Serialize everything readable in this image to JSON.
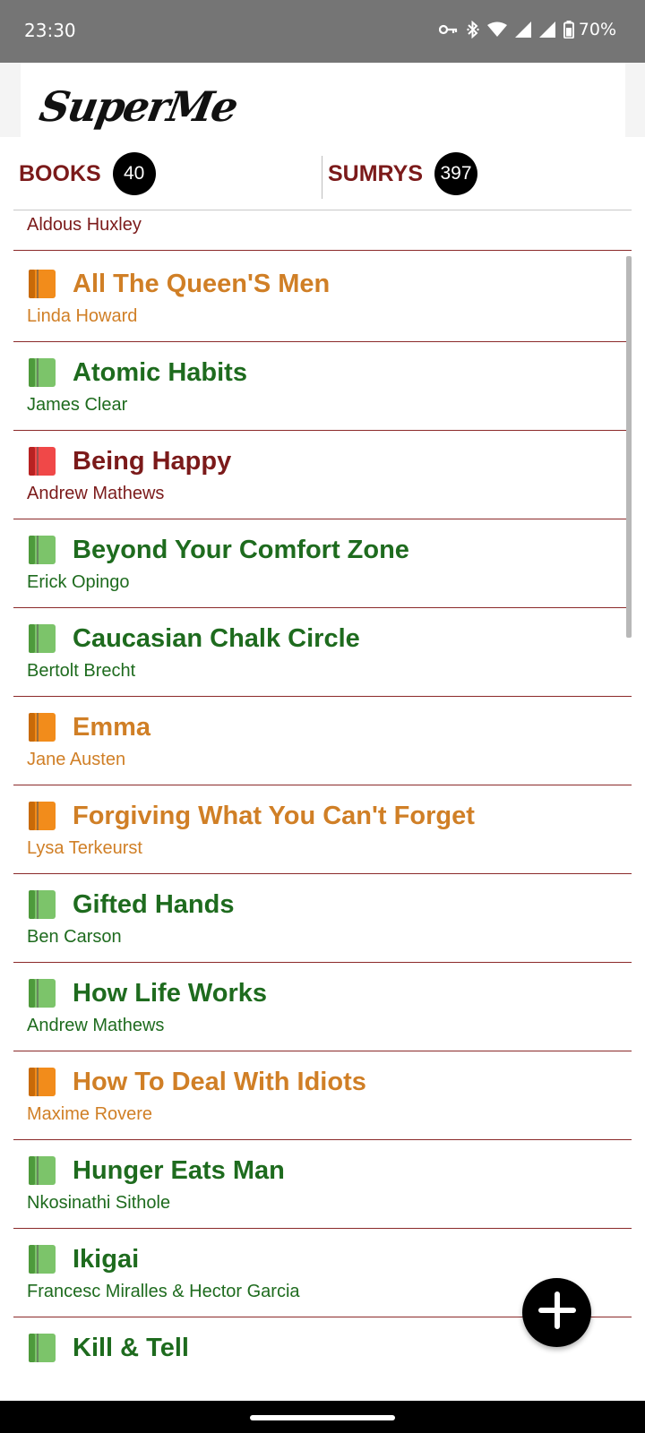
{
  "status_bar": {
    "time": "23:30",
    "icons": [
      "vpn-key-icon",
      "bluetooth-icon",
      "wifi-icon",
      "signal-icon",
      "signal-icon",
      "battery-icon"
    ],
    "battery": "70%"
  },
  "header": {
    "logo_text": "SuperMe"
  },
  "tabs": {
    "books": {
      "label": "BOOKS",
      "count": "40"
    },
    "sumrys": {
      "label": "SUMRYS",
      "count": "397"
    }
  },
  "list": {
    "partial_author": "Aldous Huxley",
    "items": [
      {
        "title": "All The Queen'S Men",
        "author": "Linda Howard",
        "icon": "orange-book-icon",
        "color": "#d07f26"
      },
      {
        "title": "Atomic Habits",
        "author": "James Clear",
        "icon": "green-book-icon",
        "color": "#1e6b1e"
      },
      {
        "title": "Being Happy",
        "author": "Andrew Mathews",
        "icon": "red-book-icon",
        "color": "#7b1a1a"
      },
      {
        "title": "Beyond Your Comfort Zone",
        "author": "Erick Opingo",
        "icon": "green-book-icon",
        "color": "#1e6b1e"
      },
      {
        "title": "Caucasian Chalk Circle",
        "author": "Bertolt Brecht",
        "icon": "green-book-icon",
        "color": "#1e6b1e"
      },
      {
        "title": "Emma",
        "author": "Jane Austen",
        "icon": "orange-book-icon",
        "color": "#d07f26"
      },
      {
        "title": "Forgiving What You Can't Forget",
        "author": "Lysa Terkeurst",
        "icon": "orange-book-icon",
        "color": "#d07f26"
      },
      {
        "title": "Gifted Hands",
        "author": "Ben Carson",
        "icon": "green-book-icon",
        "color": "#1e6b1e"
      },
      {
        "title": "How Life Works",
        "author": "Andrew Mathews",
        "icon": "green-book-icon",
        "color": "#1e6b1e"
      },
      {
        "title": "How To Deal With Idiots",
        "author": "Maxime Rovere",
        "icon": "orange-book-icon",
        "color": "#d07f26"
      },
      {
        "title": "Hunger Eats Man",
        "author": "Nkosinathi Sithole",
        "icon": "green-book-icon",
        "color": "#1e6b1e"
      },
      {
        "title": "Ikigai",
        "author": "Francesc Miralles & Hector Garcia",
        "icon": "green-book-icon",
        "color": "#1e6b1e"
      },
      {
        "title": "Kill & Tell",
        "author": "",
        "icon": "green-book-icon",
        "color": "#1e6b1e"
      }
    ]
  },
  "fab": {
    "icon": "plus-icon"
  },
  "colors": {
    "green": "#1e6b1e",
    "orange": "#d07f26",
    "maroon": "#7b1a1a",
    "status_bar": "#757575",
    "divider": "#8b2a2a"
  }
}
